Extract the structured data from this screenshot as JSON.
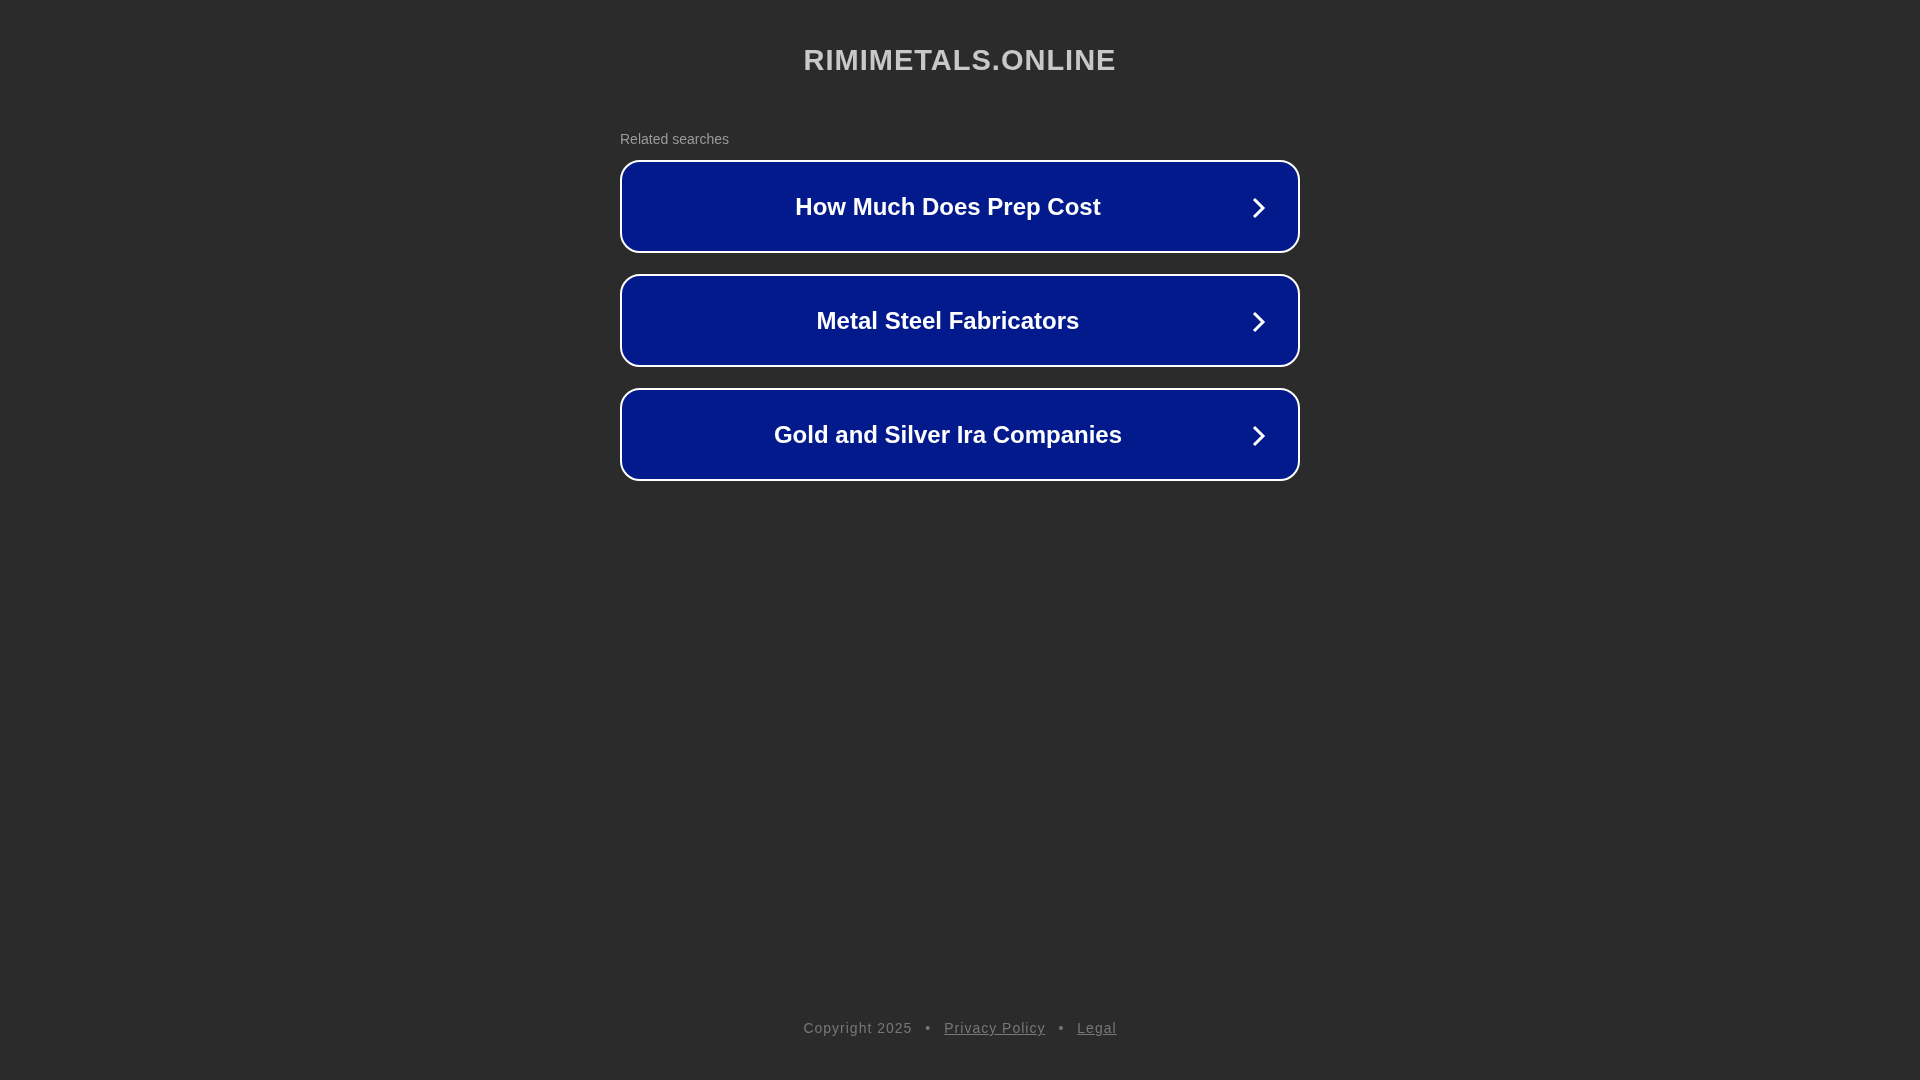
{
  "site_title": "RIMIMETALS.ONLINE",
  "related": {
    "heading": "Related searches",
    "links": [
      {
        "label": "How Much Does Prep Cost"
      },
      {
        "label": "Metal Steel Fabricators"
      },
      {
        "label": "Gold and Silver Ira Companies"
      }
    ]
  },
  "footer": {
    "copyright": "Copyright 2025",
    "separators": [
      "•",
      "•"
    ],
    "links": [
      {
        "label": "Privacy Policy"
      },
      {
        "label": "Legal"
      }
    ]
  }
}
